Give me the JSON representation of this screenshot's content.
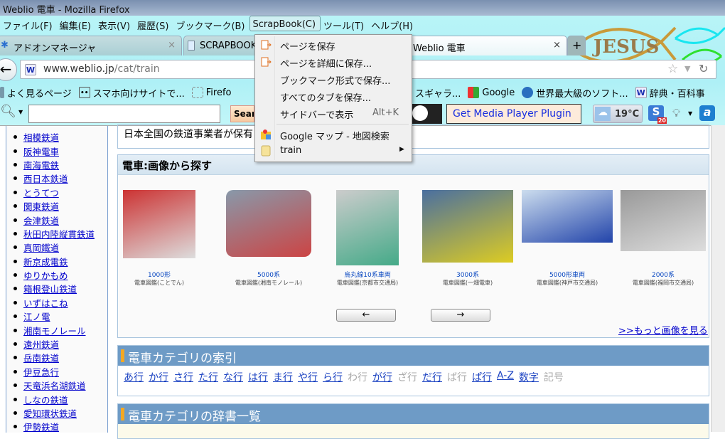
{
  "window": {
    "title": "Weblio 電車 - Mozilla Firefox"
  },
  "menubar": [
    "ファイル(F)",
    "編集(E)",
    "表示(V)",
    "履歴(S)",
    "ブックマーク(B)",
    "ScrapBook(C)",
    "ツール(T)",
    "ヘルプ(H)"
  ],
  "tabs": [
    {
      "label": "アドオンマネージャ",
      "close": "×"
    },
    {
      "label": "SCRAPBOOK"
    },
    {
      "label": "Weblio 電車",
      "close": "×"
    }
  ],
  "new_tab": "+",
  "url": {
    "host": "www.weblio.jp",
    "path": "/cat/train"
  },
  "bookmarks": [
    "よく見るページ",
    "スマホ向けサイトで...",
    "Firefo",
    "スギャラ...",
    "Google",
    "世界最大級のソフト...",
    "辞典・百科事"
  ],
  "search_toolbar": {
    "search_value": "",
    "search_button": "Sear",
    "media_plugin": "Get Media Player Plugin",
    "weather": "19°C",
    "badge": "20"
  },
  "scrapbook_menu": [
    {
      "label": "ページを保存",
      "icon": "save-page-icon"
    },
    {
      "label": "ページを詳細に保存...",
      "icon": "save-page-icon"
    },
    {
      "label": "ブックマーク形式で保存..."
    },
    {
      "label": "すべてのタブを保存..."
    },
    {
      "label": "サイドバーで表示",
      "shortcut": "Alt+K"
    },
    {
      "label": "Google マップ - 地図検索",
      "icon": "google-maps-icon"
    },
    {
      "label": "train",
      "icon": "folder-icon",
      "submenu": true
    }
  ],
  "sidebar": [
    "相模鉄道",
    "阪神電車",
    "南海電鉄",
    "西日本鉄道",
    "とうてつ",
    "関東鉄道",
    "会津鉄道",
    "秋田内陸縦貫鉄道",
    "真岡鐵道",
    "新京成電鉄",
    "ゆりかもめ",
    "箱根登山鉄道",
    "いずはこね",
    "江ノ電",
    "湘南モノレール",
    "遠州鉄道",
    "岳南鉄道",
    "伊豆急行",
    "天竜浜名湖鉄道",
    "しなの鉄道",
    "愛知環状鉄道",
    "伊勢鉄道"
  ],
  "intro_text": "日本全国の鉄道事業者が保有",
  "image_section": {
    "title": "電車:画像から探す",
    "items": [
      {
        "name": "1000形",
        "source": "電車図鑑(ことでん)"
      },
      {
        "name": "5000系",
        "source": "電車図鑑(湘南モノレール)"
      },
      {
        "name": "烏丸線10系車両",
        "source": "電車図鑑(京都市交通局)"
      },
      {
        "name": "3000系",
        "source": "電車図鑑(一畑電車)"
      },
      {
        "name": "5000形車両",
        "source": "電車図鑑(神戸市交通局)"
      },
      {
        "name": "2000系",
        "source": "電車図鑑(福岡市交通局)"
      }
    ],
    "prev": "←",
    "next": "→",
    "more": ">>もっと画像を見る"
  },
  "index_section": {
    "title": "電車カテゴリの索引",
    "links": [
      {
        "t": "あ行",
        "on": true
      },
      {
        "t": "か行",
        "on": true
      },
      {
        "t": "さ行",
        "on": true
      },
      {
        "t": "た行",
        "on": true
      },
      {
        "t": "な行",
        "on": true
      },
      {
        "t": "は行",
        "on": true
      },
      {
        "t": "ま行",
        "on": true
      },
      {
        "t": "や行",
        "on": true
      },
      {
        "t": "ら行",
        "on": true
      },
      {
        "t": "わ行",
        "on": false
      },
      {
        "t": "が行",
        "on": true
      },
      {
        "t": "ざ行",
        "on": false
      },
      {
        "t": "だ行",
        "on": true
      },
      {
        "t": "ば行",
        "on": false
      },
      {
        "t": "ぱ行",
        "on": true
      },
      {
        "t": "A-Z",
        "on": true
      },
      {
        "t": "数字",
        "on": true
      },
      {
        "t": "記号",
        "on": false
      }
    ]
  },
  "dict_section": {
    "title": "電車カテゴリの辞書一覧"
  }
}
